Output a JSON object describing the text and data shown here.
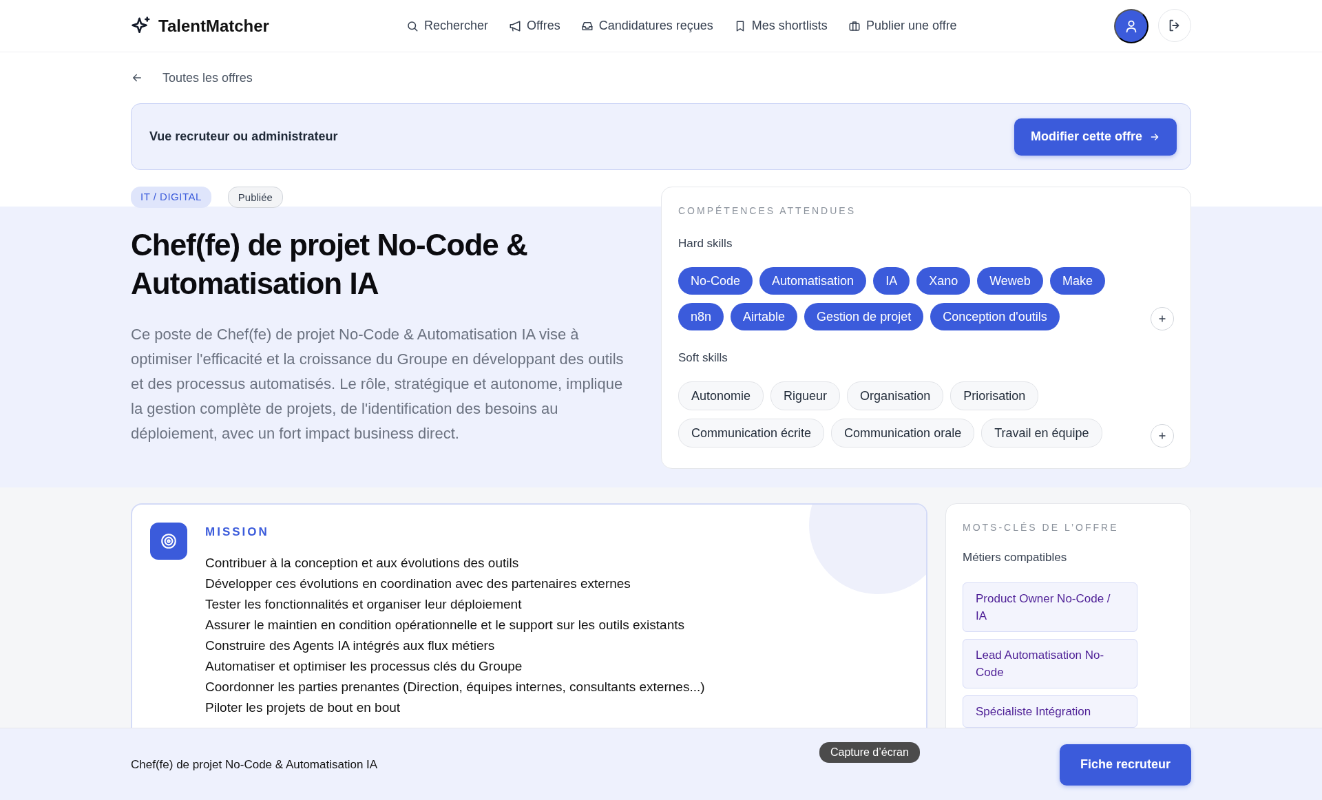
{
  "header": {
    "logo": "TalentMatcher",
    "nav": [
      {
        "label": "Rechercher"
      },
      {
        "label": "Offres"
      },
      {
        "label": "Candidatures reçues"
      },
      {
        "label": "Mes shortlists"
      },
      {
        "label": "Publier une offre"
      }
    ]
  },
  "back_link": "Toutes les offres",
  "banner": {
    "text": "Vue recruteur ou administrateur",
    "button": "Modifier cette offre"
  },
  "tags": [
    {
      "label": "IT / DIGITAL",
      "kind": "category"
    },
    {
      "label": "Publiée",
      "kind": "status"
    }
  ],
  "title": "Chef(fe) de projet No-Code & Automatisation IA",
  "description": "Ce poste de Chef(fe) de projet No-Code & Automatisation IA vise à optimiser l'efficacité et la croissance du Groupe en développant des outils et des processus automatisés. Le rôle, stratégique et autonome, implique la gestion complète de projets, de l'identification des besoins au déploiement, avec un fort impact business direct.",
  "skills": {
    "heading": "COMPÉTENCES ATTENDUES",
    "groups": [
      {
        "label": "Hard skills",
        "kind": "hard",
        "items": [
          "No-Code",
          "Automatisation",
          "IA",
          "Xano",
          "Weweb",
          "Make",
          "n8n",
          "Airtable",
          "Gestion de projet",
          "Conception d'outils"
        ]
      },
      {
        "label": "Soft skills",
        "kind": "soft",
        "items": [
          "Autonomie",
          "Rigueur",
          "Organisation",
          "Priorisation",
          "Communication écrite",
          "Communication orale",
          "Travail en équipe"
        ]
      }
    ]
  },
  "mission": {
    "heading": "MISSION",
    "items": [
      "Contribuer à la conception et aux évolutions des outils",
      "Développer ces évolutions en coordination avec des partenaires externes",
      "Tester les fonctionnalités et organiser leur déploiement",
      "Assurer le maintien en condition opérationnelle et le support sur les outils existants",
      "Construire des Agents IA intégrés aux flux métiers",
      "Automatiser et optimiser les processus clés du Groupe",
      "Coordonner les parties prenantes (Direction, équipes internes, consultants externes...)",
      "Piloter les projets de bout en bout"
    ]
  },
  "keywords": {
    "heading": "MOTS-CLÉS DE L’OFFRE",
    "subheading": "Métiers compatibles",
    "items": [
      "Product Owner No-Code / IA",
      "Lead Automatisation No-Code",
      "Spécialiste Intégration"
    ]
  },
  "bottom_bar": {
    "title": "Chef(fe) de projet No-Code & Automatisation IA",
    "button": "Fiche recruteur"
  },
  "tooltip": "Capture d’écran"
}
